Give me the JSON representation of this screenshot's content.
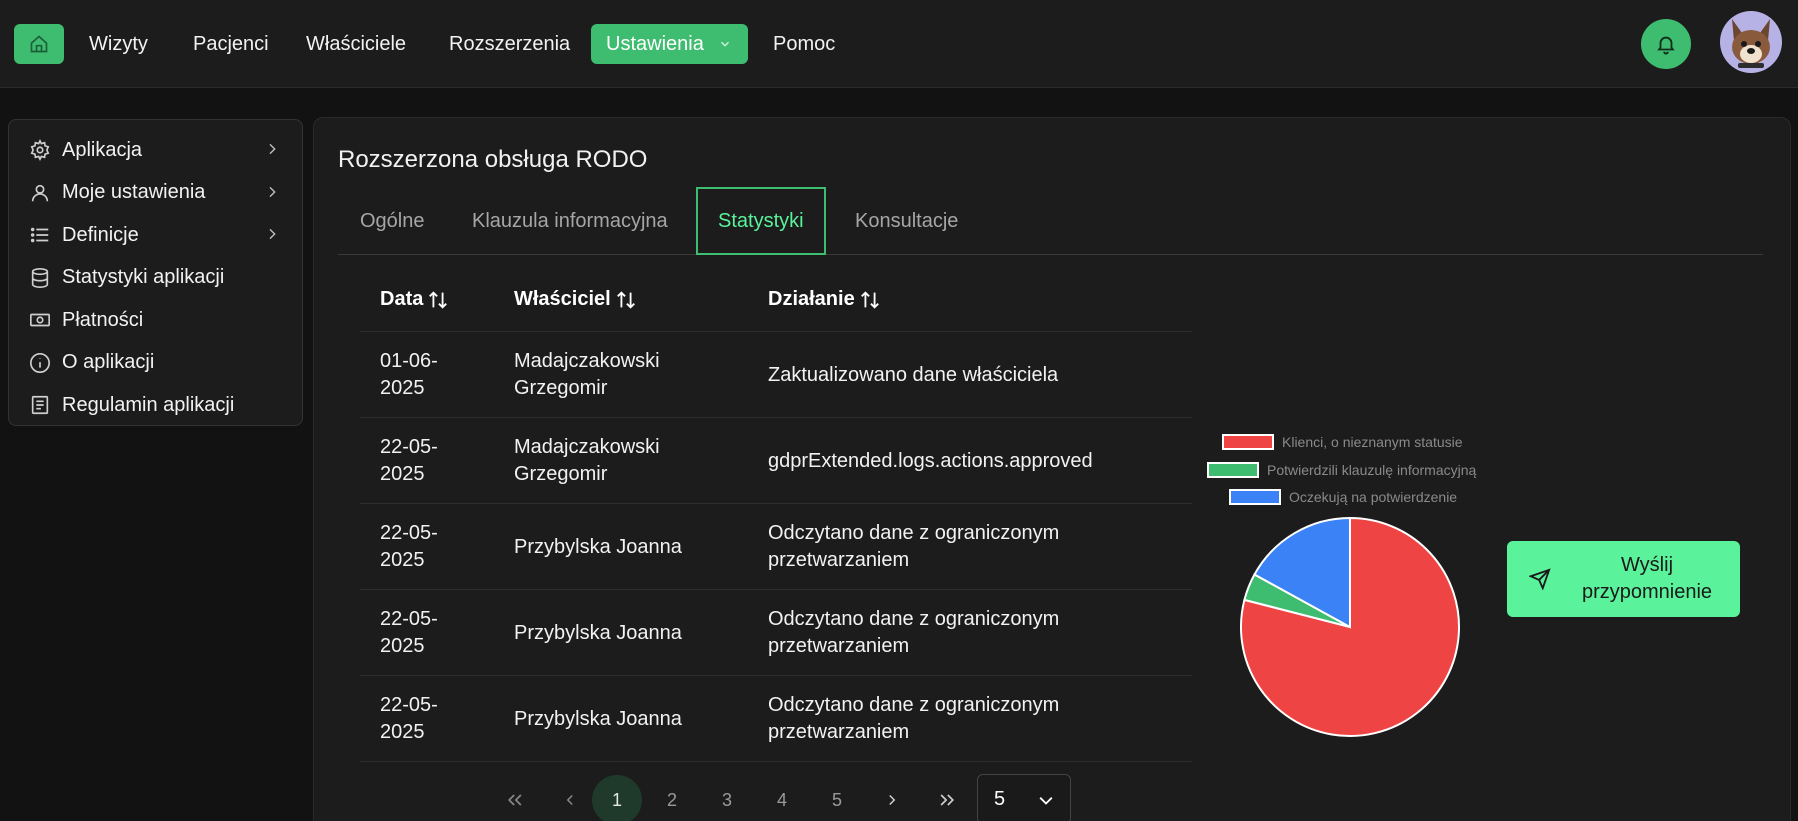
{
  "nav": {
    "items": [
      "Wizyty",
      "Pacjenci",
      "Właściciele",
      "Rozszerzenia",
      "Ustawienia",
      "Pomoc"
    ],
    "active": "Ustawienia",
    "home_icon": "home-icon",
    "bell_icon": "bell-icon"
  },
  "sidebar": {
    "items": [
      {
        "label": "Aplikacja",
        "icon": "gear-icon"
      },
      {
        "label": "Moje ustawienia",
        "icon": "user-icon"
      },
      {
        "label": "Definicje",
        "icon": "list-icon"
      },
      {
        "label": "Statystyki aplikacji",
        "icon": "database-icon"
      },
      {
        "label": "Płatności",
        "icon": "banknote-icon"
      },
      {
        "label": "O aplikacji",
        "icon": "info-icon"
      },
      {
        "label": "Regulamin aplikacji",
        "icon": "document-icon"
      }
    ]
  },
  "page": {
    "title": "Rozszerzona obsługa RODO",
    "tabs": [
      "Ogólne",
      "Klauzula informacyjna",
      "Statystyki",
      "Konsultacje"
    ],
    "active_tab": "Statystyki"
  },
  "table": {
    "columns": [
      "Data",
      "Właściciel",
      "Działanie"
    ],
    "rows": [
      [
        "01-06-\n2025",
        "Madajczakowski\nGrzegomir",
        "Zaktualizowano dane właściciela"
      ],
      [
        "22-05-\n2025",
        "Madajczakowski\nGrzegomir",
        "gdprExtended.logs.actions.approved"
      ],
      [
        "22-05-\n2025",
        "Przybylska Joanna",
        "Odczytano dane z ograniczonym\nprzetwarzaniem"
      ],
      [
        "22-05-\n2025",
        "Przybylska Joanna",
        "Odczytano dane z ograniczonym\nprzetwarzaniem"
      ],
      [
        "22-05-\n2025",
        "Przybylska Joanna",
        "Odczytano dane z ograniczonym\nprzetwarzaniem"
      ]
    ]
  },
  "pagination": {
    "first": "<<",
    "prev": "<",
    "pages": [
      "1",
      "2",
      "3",
      "4",
      "5"
    ],
    "current": "1",
    "next": ">",
    "last": ">>",
    "per_page": "5"
  },
  "chart_data": {
    "type": "pie",
    "labels": [
      "Klienci, o nieznanym statusie",
      "Potwierdzili klauzulę informacyjną",
      "Oczekują na potwierdzenie"
    ],
    "values": [
      79,
      4,
      17
    ],
    "colors": [
      "#ef4444",
      "#3ebd70",
      "#3b82f6"
    ],
    "legend": "top"
  },
  "actions": {
    "remind_label": "Wyślij\nprzypomnienie",
    "remind_icon": "send-icon"
  },
  "colors": {
    "accent": "#3ebd70",
    "accent_light": "#5af29a",
    "background": "#121212",
    "surface": "#1c1c1c"
  }
}
